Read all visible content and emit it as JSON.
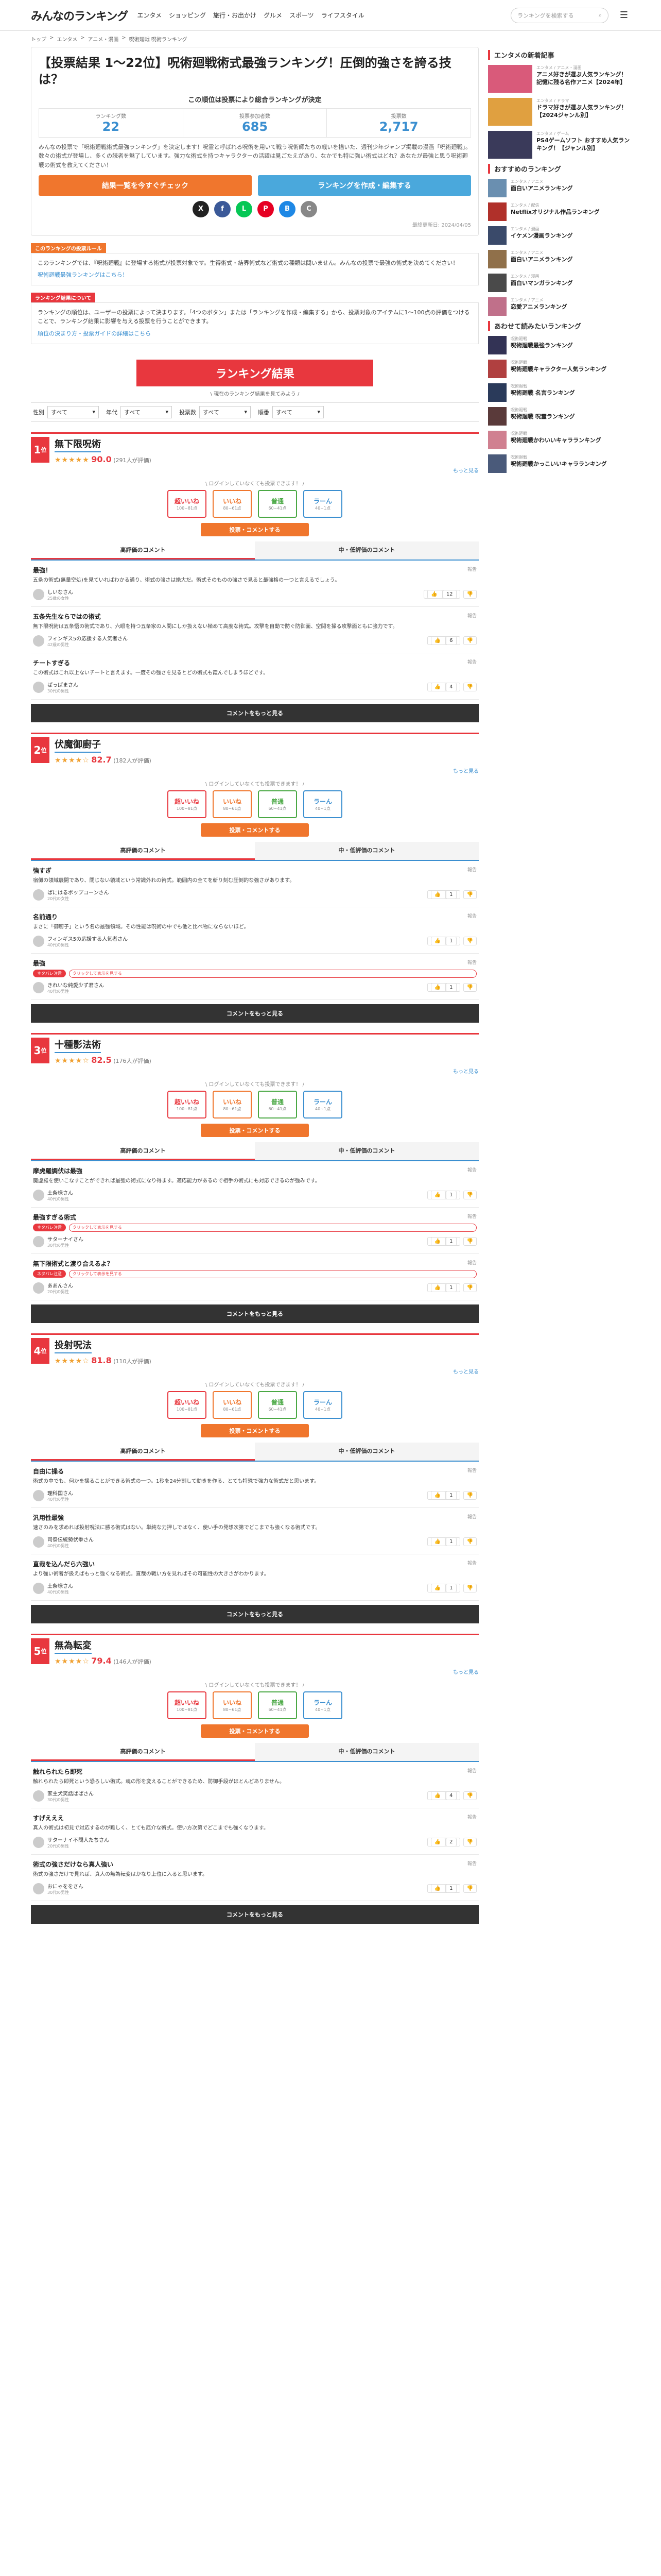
{
  "header": {
    "logo_text": "みんなのランキング",
    "nav": [
      "エンタメ",
      "ショッピング",
      "旅行・お出かけ",
      "グルメ",
      "スポーツ",
      "ライフスタイル"
    ],
    "search_placeholder": "ランキングを検索する"
  },
  "breadcrumb": [
    "トップ",
    "エンタメ",
    "アニメ・漫画",
    "呪術廻戦 呪術ランキング"
  ],
  "article": {
    "title": "【投票結果 1～22位】呪術廻戦術式最強ランキング！圧倒的強さを誇る技は？",
    "decision_line": "この順位は投票により総合ランキングが決定",
    "stats": [
      {
        "label": "ランキング数",
        "value": "22"
      },
      {
        "label": "投票参加者数",
        "value": "685"
      },
      {
        "label": "投票数",
        "value": "2,717"
      }
    ],
    "description": "みんなの投票で「呪術廻戦術式最強ランキング」を決定します！呪霊と呼ばれる呪術を用いて戦う呪術師たちの戦いを描いた、週刊少年ジャンプ掲載の漫画「呪術廻戦」。数々の術式が登場し、多くの読者を魅了しています。強力な術式を持つキャラクターの活躍は見ごたえがあり、なかでも特に強い術式はどれ？あなたが最強と思う呪術廻戦の術式を教えてください！",
    "cta_vote": "結果一覧を今すぐチェック",
    "cta_create": "ランキングを作成・編集する",
    "share": [
      {
        "label": "X",
        "color": "#222222"
      },
      {
        "label": "f",
        "color": "#3b5998"
      },
      {
        "label": "L",
        "color": "#06c755"
      },
      {
        "label": "P",
        "color": "#e60023"
      },
      {
        "label": "B",
        "color": "#1e88e5"
      },
      {
        "label": "C",
        "color": "#888888"
      }
    ],
    "date": "最終更新日: 2024/04/05"
  },
  "about": {
    "tag": "このランキングの投票ルール",
    "body": "このランキングでは、『呪術廻戦』に登場する術式が投票対象です。生得術式・結界術式など術式の種類は問いません。みんなの投票で最強の術式を決めてください！",
    "link": "呪術廻戦最強ランキングはこちら！"
  },
  "rule": {
    "tag": "ランキング結果について",
    "body": "ランキングの順位は、ユーザーの投票によって決まります。「4つのボタン」または「ランキングを作成・編集する」から、投票対象のアイテムに1〜100点の評価をつけることで、ランキング結果に影響を与える投票を行うことができます。",
    "link": "順位の決まり方・投票ガイドの詳細はこちら"
  },
  "ranking": {
    "banner": "ランキング結果",
    "note": "\\ 現在のランキング結果を見てみよう /",
    "filters": [
      {
        "label": "性別",
        "value": "すべて"
      },
      {
        "label": "年代",
        "value": "すべて"
      },
      {
        "label": "投票数",
        "value": "すべて"
      },
      {
        "label": "順番",
        "value": "すべて"
      }
    ],
    "vote_caption": "\\ ログインしていなくても投票できます！ /",
    "vote_buttons": [
      {
        "label": "超いいね",
        "range": "100~81点"
      },
      {
        "label": "いいね",
        "range": "80~61点"
      },
      {
        "label": "普通",
        "range": "60~41点"
      },
      {
        "label": "ラーん",
        "range": "40~1点"
      }
    ],
    "vote_submit": "投票・コメントする",
    "tab_high": "高評価のコメント",
    "tab_low": "中・低評価のコメント",
    "more_comments": "コメントをもっと見る",
    "more_link": "もっと見る",
    "report": "報告",
    "spoiler_tag": "ネタバレ注意",
    "spoiler_text": "クリックして表示を見する",
    "items": [
      {
        "rank": "1",
        "name": "無下限呪術",
        "stars": "★★★★★",
        "score": "90.0",
        "votes": "(291人が評価)",
        "comments": [
          {
            "title": "最強！",
            "body": "五条の術式(無量空処)を見ていればわかる通り、術式の強さは絶大だ。術式そのものの強さで見ると最強格の一つと言えるでしょう。",
            "user": "しいなさん",
            "meta": "25歳の女性",
            "likes": "12"
          },
          {
            "title": "五条先生ならではの術式",
            "body": "無下限呪術は五条悟の術式であり、六眼を持つ五条家の人間にしか扱えない極めて高度な術式。攻撃を自動で防ぐ防御面、空間を操る攻撃面ともに強力です。",
            "user": "フィンギス5の応援する人気者さん",
            "meta": "42歳の男性",
            "likes": "6"
          },
          {
            "title": "チートすぎる",
            "body": "この術式はこれ以上ないチートと言えます。一度その強さを見るとどの術式も霞んでしまうほどです。",
            "user": "ぱっぱまさん",
            "meta": "30代の男性",
            "likes": "4"
          }
        ]
      },
      {
        "rank": "2",
        "name": "伏魔御廚子",
        "stars": "★★★★☆",
        "score": "82.7",
        "votes": "(182人が評価)",
        "comments": [
          {
            "title": "強すぎ",
            "body": "宿儺の領域展開であり、閉じない領域という常識外れの術式。範囲内の全てを斬り刻む圧倒的な強さがあります。",
            "user": "ぱにはるポップコーンさん",
            "meta": "20代の女性",
            "likes": "1"
          },
          {
            "title": "名前通り",
            "body": "まさに「御廚子」という名の最強領域。その性能は呪術の中でも他と比べ物にならないほど。",
            "user": "フィンギス5の応援する人気者さん",
            "meta": "40代の男性",
            "likes": "1"
          },
          {
            "title": "最強",
            "body": "",
            "user": "きれいな純愛少ず君さん",
            "meta": "40代の男性",
            "likes": "1",
            "spoiler": true
          }
        ]
      },
      {
        "rank": "3",
        "name": "十種影法術",
        "stars": "★★★★☆",
        "score": "82.5",
        "votes": "(176人が評価)",
        "comments": [
          {
            "title": "摩虎羅調伏は最強",
            "body": "魔虚羅を使いこなすことができれば最強の術式になり得ます。適応能力があるので相手の術式にも対応できるのが強みです。",
            "user": "土条様さん",
            "meta": "40代の男性",
            "likes": "1"
          },
          {
            "title": "最強すぎる術式",
            "body": "",
            "user": "サターナイさん",
            "meta": "30代の男性",
            "likes": "1",
            "spoiler": true
          },
          {
            "title": "無下限術式と渡り合えるよ？",
            "body": "",
            "user": "ああんさん",
            "meta": "20代の男性",
            "likes": "1",
            "spoiler": true
          }
        ]
      },
      {
        "rank": "4",
        "name": "投射呪法",
        "stars": "★★★★☆",
        "score": "81.8",
        "votes": "(110人が評価)",
        "comments": [
          {
            "title": "自由に操る",
            "body": "術式の中でも、何かを操ることができる術式の一つ。1秒を24分割して動きを作る、とても特殊で強力な術式だと思います。",
            "user": "理科国さん",
            "meta": "40代の男性",
            "likes": "1"
          },
          {
            "title": "汎用性最強",
            "body": "速さのみを求めれば投射呪法に勝る術式はない。単純な力押しではなく、使い手の発想次第でどこまでも強くなる術式です。",
            "user": "司祭伝統勢伏拳さん",
            "meta": "40代の男性",
            "likes": "1"
          },
          {
            "title": "直哉を込んだら六強い",
            "body": "より強い術者が扱えばもっと強くなる術式。直哉の戦い方を見ればその可能性の大きさがわかります。",
            "user": "土条様さん",
            "meta": "40代の男性",
            "likes": "1"
          }
        ]
      },
      {
        "rank": "5",
        "name": "無為転変",
        "stars": "★★★★☆",
        "score": "79.4",
        "votes": "(146人が評価)",
        "comments": [
          {
            "title": "触れられたら即死",
            "body": "触れられたら即死という恐ろしい術式。魂の形を変えることができるため、防御手段がほとんどありません。",
            "user": "家主犬笑話ぱぱさん",
            "meta": "30代の男性",
            "likes": "4"
          },
          {
            "title": "すげえええ",
            "body": "真人の術式は初見で対応するのが難しく、とても厄介な術式。使い方次第でどこまでも強くなります。",
            "user": "サターナイ不問人たちさん",
            "meta": "20代の男性",
            "likes": "2"
          },
          {
            "title": "術式の強さだけなら真人強い",
            "body": "術式の強さだけで見れば、真人の無為転変はかなり上位に入ると思います。",
            "user": "おにゃををさん",
            "meta": "30代の男性",
            "likes": "1"
          }
        ]
      }
    ]
  },
  "sidebar": {
    "new_title": "エンタメの新着記事",
    "new_items": [
      {
        "cat": "エンタメ / アニメ・漫画",
        "title": "アニメ好きが選ぶ人気ランキング！記憶に残る名作アニメ【2024年】",
        "color": "#d95a7a"
      },
      {
        "cat": "エンタメ / ドラマ",
        "title": "ドラマ好きが選ぶ人気ランキング！【2024ジャンル別】",
        "color": "#e0a040"
      },
      {
        "cat": "エンタメ / ゲーム",
        "title": "PS4ゲームソフト おすすめ人気ランキング！【ジャンル別】",
        "color": "#3a3a5a"
      }
    ],
    "rec_title": "おすすめのランキング",
    "rec_items": [
      {
        "cat": "エンタメ / アニメ",
        "title": "面白いアニメランキング",
        "color": "#6a8fb0"
      },
      {
        "cat": "エンタメ / 配信",
        "title": "Netflixオリジナル作品ランキング",
        "color": "#b0302a"
      },
      {
        "cat": "エンタメ / 漫画",
        "title": "イケメン漫画ランキング",
        "color": "#3a4a6a"
      },
      {
        "cat": "エンタメ / アニメ",
        "title": "面白いアニメランキング",
        "color": "#90704a"
      },
      {
        "cat": "エンタメ / 漫画",
        "title": "面白いマンガランキング",
        "color": "#4a4a4a"
      },
      {
        "cat": "エンタメ / アニメ",
        "title": "恋愛アニメランキング",
        "color": "#c0708a"
      }
    ],
    "also_title": "あわせて読みたいランキング",
    "also_items": [
      {
        "cat": "呪術廻戦",
        "title": "呪術廻戦最強ランキング",
        "color": "#333355"
      },
      {
        "cat": "呪術廻戦",
        "title": "呪術廻戦キャラクター人気ランキング",
        "color": "#b04040"
      },
      {
        "cat": "呪術廻戦",
        "title": "呪術廻戦 名言ランキング",
        "color": "#2a3a5a"
      },
      {
        "cat": "呪術廻戦",
        "title": "呪術廻戦 呪霊ランキング",
        "color": "#5a3a3a"
      },
      {
        "cat": "呪術廻戦",
        "title": "呪術廻戦かわいいキャラランキング",
        "color": "#d08090"
      },
      {
        "cat": "呪術廻戦",
        "title": "呪術廻戦かっこいいキャラランキング",
        "color": "#4a5a7a"
      }
    ]
  }
}
